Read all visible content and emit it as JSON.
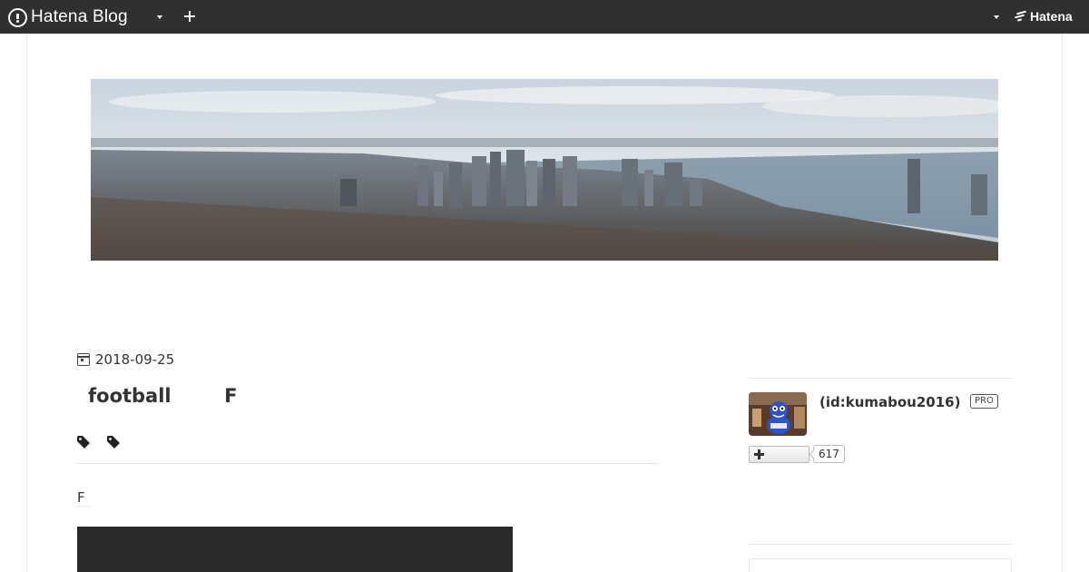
{
  "topbar": {
    "brand_label": "Hatena Blog",
    "hatena_label": "Hatena",
    "background": "#303030",
    "icons": [
      "hatena-blog-logo-icon",
      "chevron-down-icon",
      "plus-icon",
      "chevron-down-icon",
      "hatena-logo-icon"
    ]
  },
  "entry": {
    "date": "2018-09-25",
    "title": "football        F",
    "body_text": "F",
    "tags": [
      "tag-icon",
      "tag-icon"
    ]
  },
  "sidebar": {
    "user_id": "(id:kumabou2016)",
    "pro_label": "PRO",
    "follower_count": "617"
  }
}
